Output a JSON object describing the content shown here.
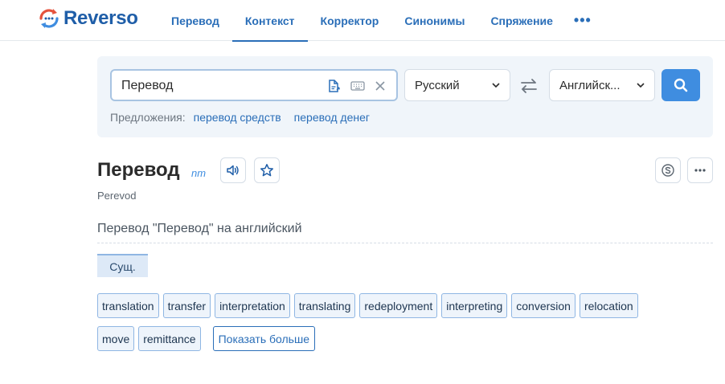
{
  "header": {
    "logo_text": "Reverso",
    "nav": [
      {
        "label": "Перевод"
      },
      {
        "label": "Контекст"
      },
      {
        "label": "Корректор"
      },
      {
        "label": "Синонимы"
      },
      {
        "label": "Спряжение"
      }
    ],
    "active_index": 1,
    "more_label": "•••"
  },
  "search": {
    "value": "Перевод",
    "source_lang": "Русский",
    "target_lang": "Английск...",
    "suggestions_label": "Предложения:",
    "suggestions": [
      "перевод средств",
      "перевод денег"
    ]
  },
  "entry": {
    "word": "Перевод",
    "pos_short": "nm",
    "transliteration": "Perevod",
    "section_title": "Перевод \"Перевод\" на английский",
    "pos_tag": "Сущ.",
    "translations": [
      "translation",
      "transfer",
      "interpretation",
      "translating",
      "redeployment",
      "interpreting",
      "conversion",
      "relocation",
      "move",
      "remittance"
    ],
    "show_more": "Показать больше"
  },
  "colors": {
    "brand": "#1f5ea8",
    "accent": "#3f8de0",
    "logo_red": "#e5533d"
  }
}
